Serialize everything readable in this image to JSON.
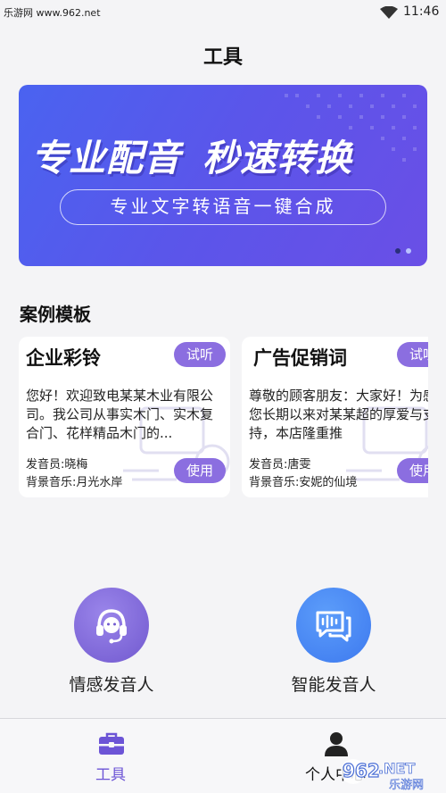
{
  "status_bar": {
    "watermark": "乐游网 www.962.net",
    "time": "11:46"
  },
  "header": {
    "title": "工具"
  },
  "banner": {
    "headline_left": "专业配音",
    "headline_right": "秒速转换",
    "subtitle": "专业文字转语音一键合成",
    "page_count": 2,
    "active_page": 1
  },
  "templates": {
    "section_title": "案例模板",
    "cards": [
      {
        "title": "企业彩铃",
        "listen_label": "试听",
        "text": "您好！欢迎致电某某木业有限公司。我公司从事实木门、实木复合门、花样精品木门的...",
        "use_label": "使用",
        "speaker": "发音员:晓梅",
        "music": "背景音乐:月光水岸"
      },
      {
        "title": "广告促销词",
        "listen_label": "试听",
        "text": "尊敬的顾客朋友：大家好！为感谢您长期以来对某某超的厚爱与支持，本店隆重推",
        "use_label": "使用",
        "speaker": "发音员:唐雯",
        "music": "背景音乐:安妮的仙境"
      }
    ]
  },
  "features": [
    {
      "label": "情感发音人",
      "icon": "headset-icon",
      "color": "#7f68d9"
    },
    {
      "label": "智能发音人",
      "icon": "voice-chat-icon",
      "color": "#4a86f3"
    }
  ],
  "bottom_nav": {
    "tools_label": "工具",
    "me_label": "个人中心",
    "active": "tools",
    "active_color": "#6c54d6"
  },
  "watermark_logo": {
    "number": "962",
    "suffix": ".NET",
    "text": "乐游网"
  }
}
